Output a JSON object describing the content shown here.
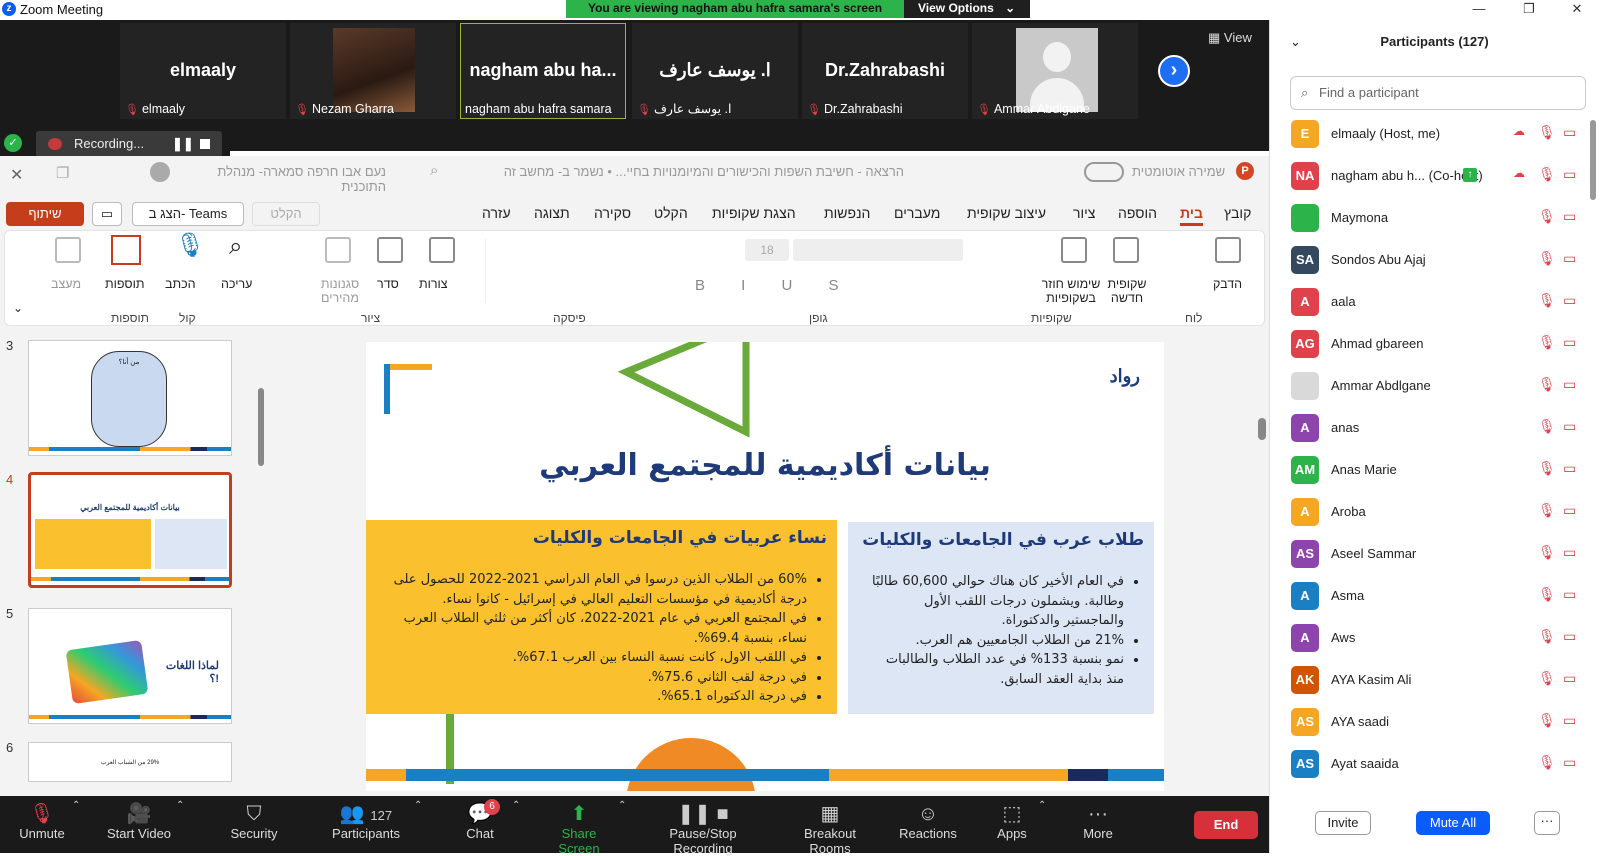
{
  "window": {
    "title": "Zoom Meeting",
    "minimize": "—",
    "restore": "❐",
    "close": "✕"
  },
  "banner": {
    "text": "You are viewing nagham abu hafra samara's screen",
    "view_options": "View Options"
  },
  "video_strip": {
    "view_label": "View",
    "tiles": [
      {
        "big": "elmaaly",
        "caption": "elmaaly"
      },
      {
        "big": "",
        "caption": "Nezam Gharra"
      },
      {
        "big": "nagham  abu  ha...",
        "caption": "nagham abu hafra samara"
      },
      {
        "big": "ا. يوسف عارف",
        "caption": "ا. يوسف عارف"
      },
      {
        "big": "Dr.Zahrabashi",
        "caption": "Dr.Zahrabashi"
      },
      {
        "big": "",
        "caption": "Ammar Abdlgane"
      }
    ]
  },
  "recording": {
    "label": "Recording...",
    "pause": "❚❚"
  },
  "ppt": {
    "autosave": "שמירה אוטומטית",
    "doc_title": "הרצאה - חשיבת השפות והכישורים והמיומנויות בחיי... • נשמר ב- מחשב זה",
    "user": "נעם אבו חרפה סמארה- מנהלת התוכנית",
    "tabs": [
      "קובץ",
      "בית",
      "הוספה",
      "ציור",
      "עיצוב שקופית",
      "מעברים",
      "הנפשות",
      "הצגת שקופיות",
      "הקלט",
      "סקירה",
      "תצוגה",
      "עזרה"
    ],
    "share": "שיתוף",
    "teams": "הצג ב- Teams",
    "record": "הקלט",
    "ribbon_groups": [
      "לוח",
      "שקופיות",
      "גופן",
      "פיסקה",
      "ציור",
      "קול",
      "תוספות"
    ],
    "ribbon_buttons": {
      "paste": "הדבק",
      "new_slide": "שקופית חדשה",
      "reuse": "שימוש חוזר בשקופיות",
      "shapes": "צורות",
      "arrange": "סדר",
      "styles": "סגנונות מהירים",
      "edit": "עריכה",
      "dictate": "הכתב",
      "addins": "תוספות",
      "designer": "מעצב",
      "font_size": "18"
    }
  },
  "thumbnails": [
    {
      "num": "3",
      "text": "من أنا؟"
    },
    {
      "num": "4",
      "text": "بيانات أكاديمية للمجتمع العربي"
    },
    {
      "num": "5",
      "text": "لماذا اللغات !؟"
    },
    {
      "num": "6",
      "text": "29% من الشباب العرب"
    }
  ],
  "slide": {
    "title": "بيانات أكاديمية للمجتمع العربي",
    "right_box": {
      "heading": "طلاب عرب في الجامعات والكليات",
      "bullets": [
        "في العام الأخير كان هناك حوالي 60,600 طالبًا وطالبة. ويشملون درجات اللقب الأول والماجستير والدكتوراة.",
        "21% من الطلاب الجامعيين هم العرب.",
        "نمو بنسبة 133% في عدد الطلاب والطالبات منذ بداية العقد السابق."
      ]
    },
    "left_box": {
      "heading": "نساء عربيات في الجامعات والكليات",
      "bullets": [
        "60% من الطلاب الذين درسوا في العام الدراسي 2021-2022 للحصول على درجة أكاديمية في مؤسسات التعليم العالي في إسرائيل - كانوا نساء.",
        "في المجتمع العربي في عام 2021-2022، كان أكثر من ثلثي الطلاب العرب نساء، بنسبة 69.4%.",
        "في اللقب الاول، كانت نسبة النساء بين العرب 67.1%.",
        "في درجة لقب الثاني 75.6%.",
        "في درجة الدكتوراه 65.1%."
      ]
    },
    "logo_text": "رواد"
  },
  "participants": {
    "title": "Participants (127)",
    "search_placeholder": "Find a participant",
    "list": [
      {
        "initials": "E",
        "name": "elmaaly (Host, me)",
        "color": "#f5a623"
      },
      {
        "initials": "NA",
        "name": "nagham abu h... (Co-host)",
        "color": "#e0424b"
      },
      {
        "initials": "",
        "name": "Maymona",
        "color": "#2cb34a"
      },
      {
        "initials": "SA",
        "name": "Sondos Abu Ajaj",
        "color": "#34495e"
      },
      {
        "initials": "A",
        "name": "aala",
        "color": "#e0424b"
      },
      {
        "initials": "AG",
        "name": "Ahmad gbareen",
        "color": "#e0424b"
      },
      {
        "initials": "",
        "name": "Ammar Abdlgane",
        "color": "#d9d9d9"
      },
      {
        "initials": "A",
        "name": "anas",
        "color": "#8e44ad"
      },
      {
        "initials": "AM",
        "name": "Anas Marie",
        "color": "#2cb34a"
      },
      {
        "initials": "A",
        "name": "Aroba",
        "color": "#f5a623"
      },
      {
        "initials": "AS",
        "name": "Aseel Sammar",
        "color": "#8e44ad"
      },
      {
        "initials": "A",
        "name": "Asma",
        "color": "#1b7fc4"
      },
      {
        "initials": "A",
        "name": "Aws",
        "color": "#8e44ad"
      },
      {
        "initials": "AK",
        "name": "AYA Kasim Ali",
        "color": "#d35400"
      },
      {
        "initials": "AS",
        "name": "AYA saadi",
        "color": "#f5a623"
      },
      {
        "initials": "AS",
        "name": "Ayat saaida",
        "color": "#1b7fc4"
      }
    ],
    "invite": "Invite",
    "mute_all": "Mute All",
    "more": "···"
  },
  "toolbar": {
    "unmute": "Unmute",
    "start_video": "Start Video",
    "security": "Security",
    "participants": "Participants",
    "participants_count": "127",
    "chat": "Chat",
    "chat_badge": "6",
    "share_screen": "Share Screen",
    "pause_recording": "Pause/Stop Recording",
    "breakout": "Breakout Rooms",
    "reactions": "Reactions",
    "apps": "Apps",
    "more": "More",
    "end": "End"
  }
}
